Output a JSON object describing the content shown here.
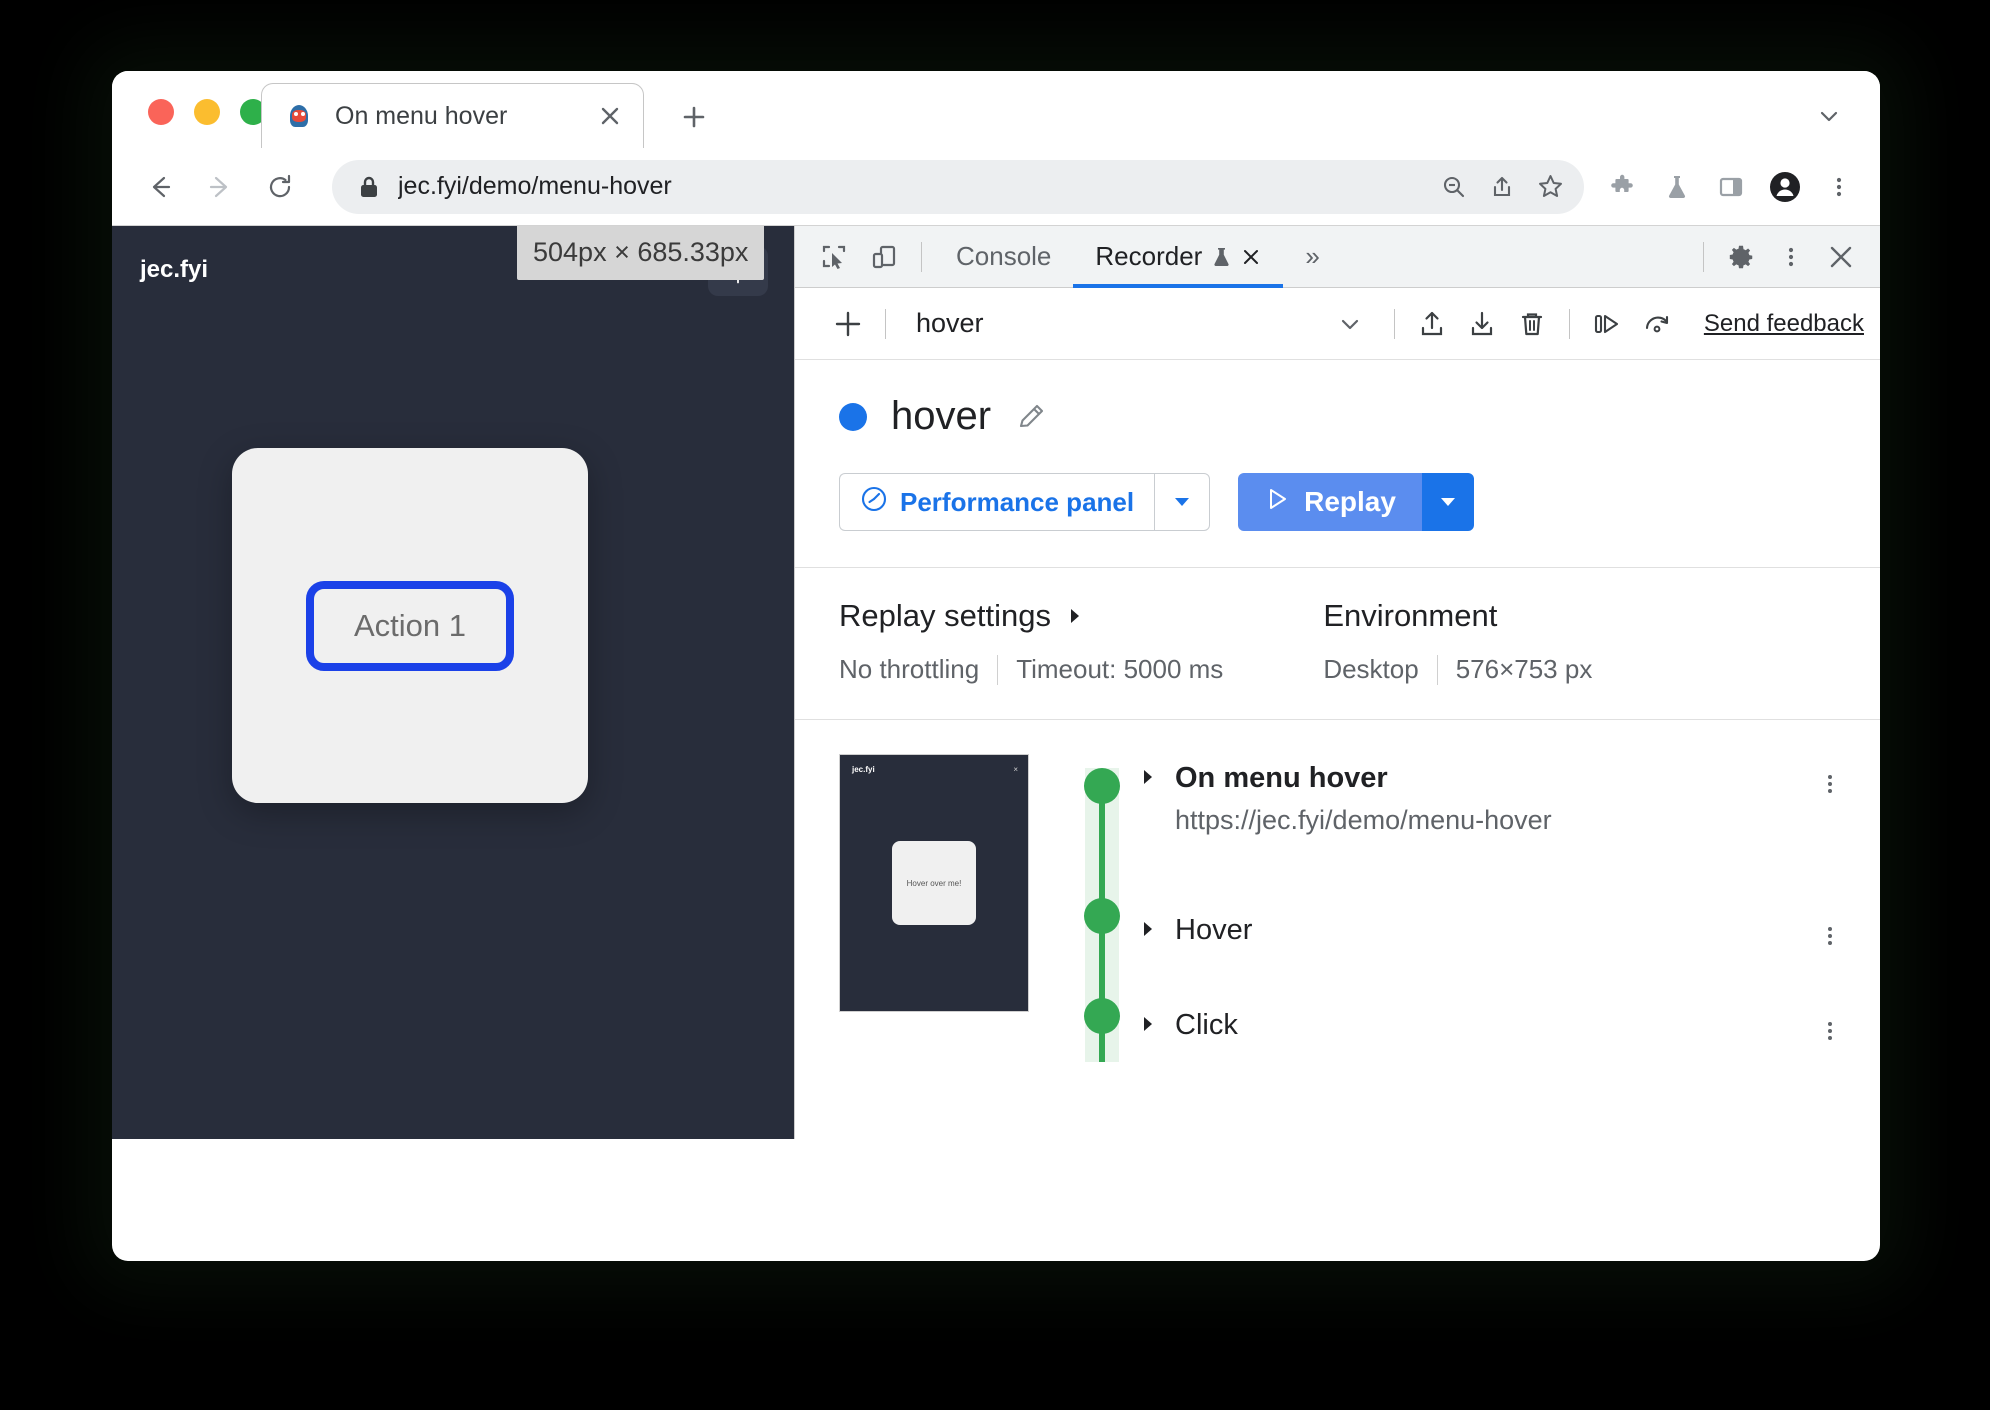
{
  "browser": {
    "tab": {
      "title": "On menu hover",
      "favicon": "penguin-favicon",
      "close": "×"
    },
    "new_tab_label": "+",
    "tabstrip_chevron": "chevron-down-icon",
    "omnibox": {
      "url": "jec.fyi/demo/menu-hover",
      "lock_icon": "lock-icon",
      "zoom_out_icon": "zoom-out-icon",
      "share_icon": "share-icon",
      "bookmark_icon": "star-icon"
    },
    "toolbar_icons": [
      "extensions-puzzle-icon",
      "flask-icon",
      "side-panel-icon",
      "profile-avatar-icon",
      "kebab-menu-icon"
    ],
    "nav": {
      "back": "back-arrow-icon",
      "forward": "forward-arrow-icon",
      "reload": "reload-icon"
    }
  },
  "viewport": {
    "site_logo": "jec.fyi",
    "size_tooltip": "504px × 685.33px",
    "theme_toggle_icon": "sun-icon",
    "action_button": "Action 1"
  },
  "devtools": {
    "tabs": [
      {
        "label": "Console",
        "active": false
      },
      {
        "label": "Recorder",
        "active": true,
        "badge": "flask-icon",
        "closable": "×"
      }
    ],
    "more_tabs": "»",
    "left_icons": [
      "inspect-element-icon",
      "device-toolbar-icon"
    ],
    "right_icons": [
      "settings-gear-icon",
      "kebab-menu-icon",
      "close-devtools-icon"
    ],
    "recorder_toolbar": {
      "add_label": "+",
      "recording_name": "hover",
      "select_chevron": "chevron-down-icon",
      "export_icon": "export-upload-icon",
      "import_icon": "import-download-icon",
      "delete_icon": "trash-icon",
      "step_icon": "step-over-icon",
      "replay_timeout_icon": "replay-speed-icon",
      "feedback_label": "Send feedback"
    },
    "recording": {
      "title": "hover",
      "status_dot_color": "#1a73e8",
      "edit_icon": "pencil-icon",
      "performance_button": {
        "label": "Performance panel",
        "icon": "performance-gauge-icon",
        "dropdown": "chevron-down-icon"
      },
      "replay_button": {
        "label": "Replay",
        "icon": "play-triangle-icon",
        "dropdown": "chevron-down-icon"
      }
    },
    "settings": {
      "replay": {
        "title": "Replay settings",
        "caret": "caret-right-icon",
        "throttling": "No throttling",
        "timeout": "Timeout: 5000 ms"
      },
      "environment": {
        "title": "Environment",
        "device": "Desktop",
        "dimensions": "576×753 px"
      }
    },
    "thumbnail": {
      "logo": "jec.fyi",
      "close": "×",
      "card_text": "Hover over me!"
    },
    "steps": [
      {
        "label": "On menu hover",
        "sublabel": "https://jec.fyi/demo/menu-hover",
        "bold": true,
        "menu": "kebab-menu-icon",
        "caret": "caret-right-icon"
      },
      {
        "label": "Hover",
        "sublabel": "",
        "bold": false,
        "menu": "kebab-menu-icon",
        "caret": "caret-right-icon"
      },
      {
        "label": "Click",
        "sublabel": "",
        "bold": false,
        "menu": "kebab-menu-icon",
        "caret": "caret-right-icon"
      }
    ]
  }
}
